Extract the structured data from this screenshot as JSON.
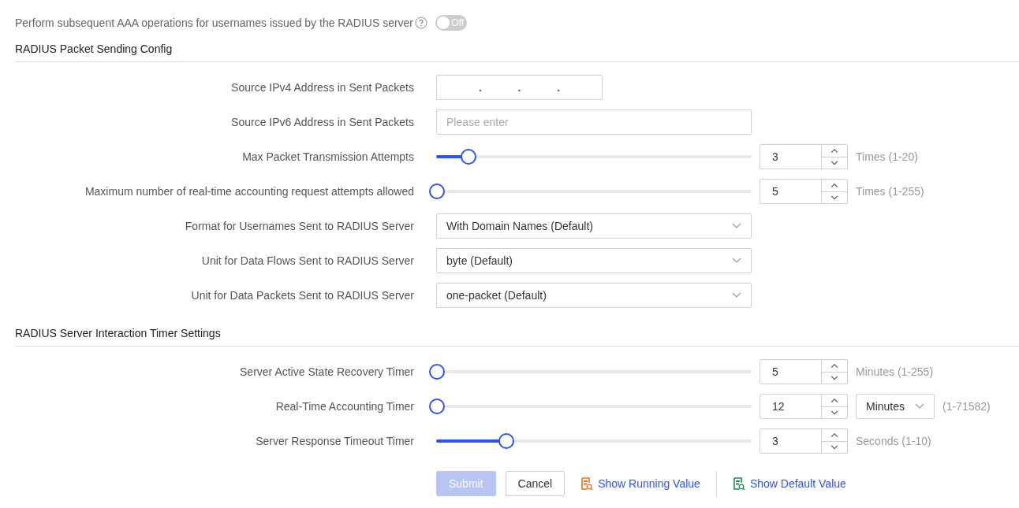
{
  "top_setting": {
    "label": "Perform subsequent AAA operations for usernames issued by the RADIUS server",
    "toggle": {
      "on": false,
      "text": "Off"
    }
  },
  "sections": [
    {
      "title": "RADIUS Packet Sending Config",
      "rows": [
        {
          "kind": "ipv4",
          "label": "Source IPv4 Address in Sent Packets",
          "separators": [
            ".",
            ".",
            "."
          ]
        },
        {
          "kind": "text",
          "label": "Source IPv6 Address in Sent Packets",
          "placeholder": "Please enter"
        },
        {
          "kind": "slider",
          "label": "Max Packet Transmission Attempts",
          "level": 0.1,
          "value": "3",
          "range": "Times (1-20)"
        },
        {
          "kind": "slider",
          "label": "Maximum number of real-time accounting request attempts allowed",
          "level": 0,
          "value": "5",
          "range": "Times (1-255)"
        },
        {
          "kind": "select",
          "label": "Format for Usernames Sent to RADIUS Server",
          "value": "With Domain Names (Default)"
        },
        {
          "kind": "select",
          "label": "Unit for Data Flows Sent to RADIUS Server",
          "value": "byte (Default)"
        },
        {
          "kind": "select",
          "label": "Unit for Data Packets Sent to RADIUS Server",
          "value": "one-packet (Default)"
        }
      ]
    },
    {
      "title": "RADIUS Server Interaction Timer Settings",
      "rows": [
        {
          "kind": "slider",
          "label": "Server Active State Recovery Timer",
          "level": 0,
          "value": "5",
          "range": "Minutes (1-255)"
        },
        {
          "kind": "slider",
          "label": "Real-Time Accounting Timer",
          "level": 0,
          "value": "12",
          "unit": "Minutes",
          "range": "(1-71582)"
        },
        {
          "kind": "slider",
          "label": "Server Response Timeout Timer",
          "level": 0.22,
          "value": "3",
          "range": "Seconds (1-10)"
        }
      ]
    }
  ],
  "actions": {
    "submit": {
      "label": "Submit",
      "disabled": true
    },
    "cancel": "Cancel",
    "links": [
      {
        "label": "Show Running Value",
        "color": "#e8731c"
      },
      {
        "label": "Show Default Value",
        "color": "#1f8a4c"
      }
    ]
  }
}
